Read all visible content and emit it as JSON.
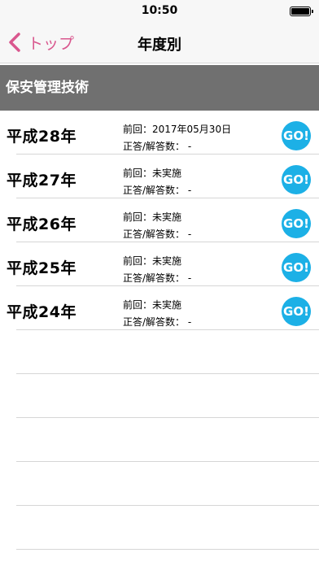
{
  "status_bar": {
    "time": "10:50"
  },
  "nav": {
    "back_label": "トップ",
    "title": "年度別"
  },
  "section": {
    "title": "保安管理技術"
  },
  "exams": [
    {
      "year": "平成28年",
      "previous": "前回：2017年05月30日",
      "score": "正答/解答数： -",
      "go": "GO!"
    },
    {
      "year": "平成27年",
      "previous": "前回：未実施",
      "score": "正答/解答数： -",
      "go": "GO!"
    },
    {
      "year": "平成26年",
      "previous": "前回：未実施",
      "score": "正答/解答数： -",
      "go": "GO!"
    },
    {
      "year": "平成25年",
      "previous": "前回：未実施",
      "score": "正答/解答数： -",
      "go": "GO!"
    },
    {
      "year": "平成24年",
      "previous": "前回：未実施",
      "score": "正答/解答数： -",
      "go": "GO!"
    }
  ],
  "colors": {
    "accent": "#d9578e",
    "go_button": "#1cb0e6",
    "section_bg": "#707070"
  }
}
